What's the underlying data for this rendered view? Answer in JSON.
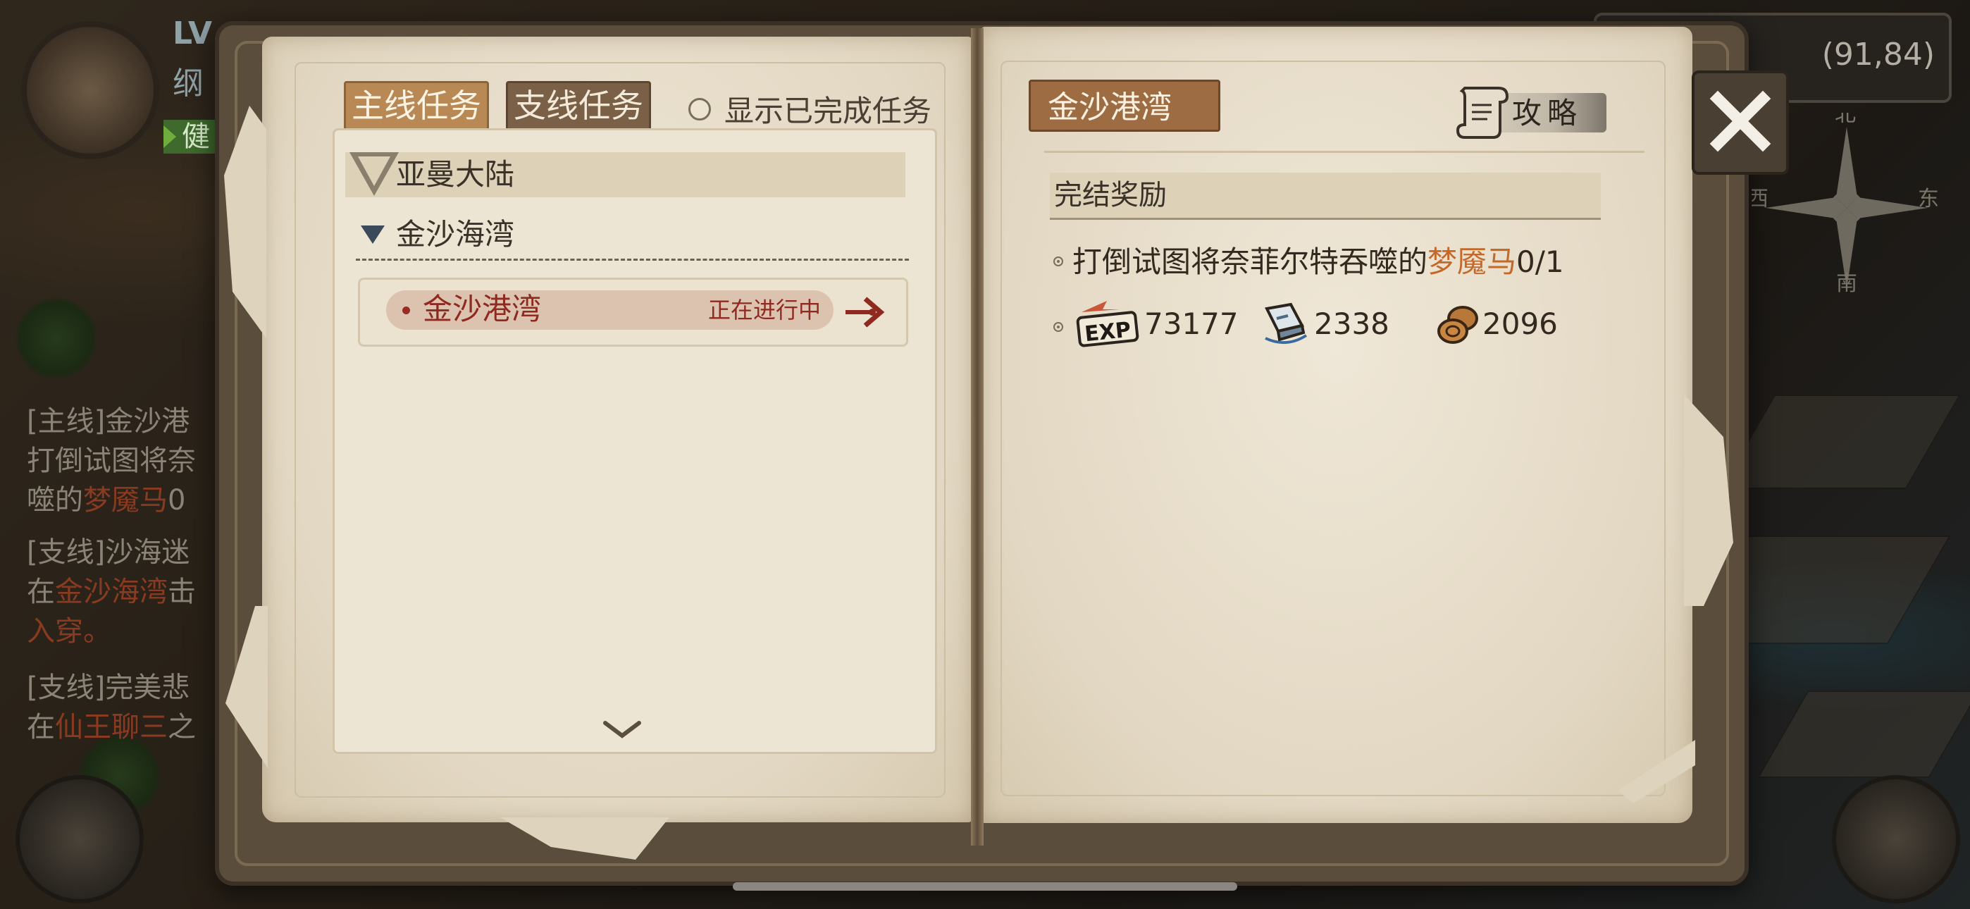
{
  "background": {
    "player_level_label": "LV",
    "player_name_partial": "纲",
    "health_label": "健",
    "side_quests": [
      {
        "title": "[主线]金沙港",
        "body": "打倒试图将奈",
        "body2_prefix": "噬的",
        "body2_red": "梦魇马",
        "body2_suffix": "0"
      },
      {
        "title": "[支线]沙海迷",
        "body": "在",
        "body_red": "金沙海湾",
        "body_suffix": "击",
        "body2": "入穿。"
      },
      {
        "title": "[支线]完美悲",
        "body": "在",
        "body_red": "仙王聊三",
        "body_suffix": "之"
      }
    ],
    "coordinates": "(91,84)",
    "compass": {
      "north": "北",
      "south": "南",
      "east": "东",
      "west": "西"
    }
  },
  "left_page": {
    "tabs": [
      {
        "label": "主线任务",
        "active": true
      },
      {
        "label": "支线任务",
        "active": false
      }
    ],
    "show_completed_label": "显示已完成任务",
    "show_completed_checked": false,
    "region": "亚曼大陆",
    "subregion": "金沙海湾",
    "quests": [
      {
        "name": "金沙港湾",
        "status": "正在进行中"
      }
    ]
  },
  "right_page": {
    "quest_title": "金沙港湾",
    "guide_label": "攻略",
    "reward_section_title": "完结奖励",
    "objective": {
      "prefix": "打倒试图将奈菲尔特吞噬的",
      "target": "梦魇马",
      "progress": "0/1"
    },
    "rewards": {
      "exp_icon": "exp-icon",
      "exp_value": "73177",
      "book_icon": "book-icon",
      "book_value": "2338",
      "coin_icon": "coin-icon",
      "coin_value": "2096"
    }
  },
  "colors": {
    "quest_red": "#8f2a21",
    "target_orange": "#c4692a",
    "tab_active": "#b88955",
    "tab_inactive": "#7a6047",
    "paper": "#e8dfcd"
  }
}
